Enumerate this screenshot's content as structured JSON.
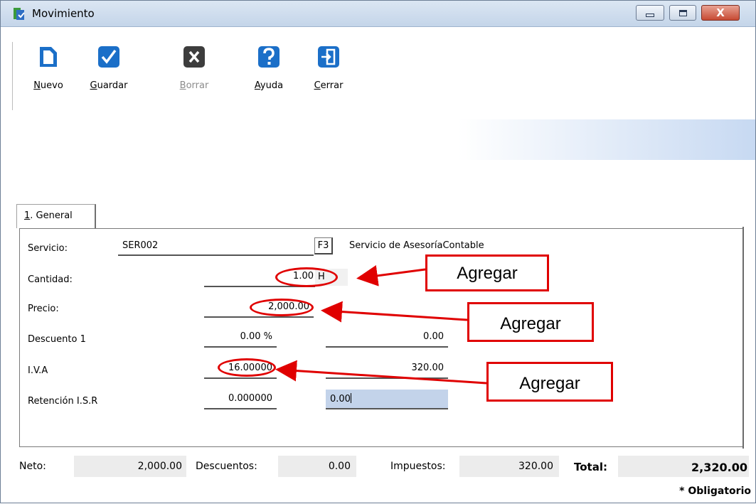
{
  "window": {
    "title": "Movimiento",
    "close_glyph": "X"
  },
  "toolbar": {
    "nuevo": "Nuevo",
    "guardar": "Guardar",
    "borrar": "Borrar",
    "ayuda": "Ayuda",
    "cerrar": "Cerrar"
  },
  "tab": {
    "number": "1",
    "label": ". General"
  },
  "form": {
    "servicio_label": "Servicio:",
    "servicio_code": "SER002",
    "f3_label": "F3",
    "servicio_desc": "Servicio de AsesoríaContable",
    "cantidad_label": "Cantidad:",
    "cantidad_value": "1.00",
    "cantidad_unit": "H",
    "precio_label": "Precio:",
    "precio_value": "2,000.00",
    "descuento_label": "Descuento 1",
    "descuento_pct": "0.00 %",
    "descuento_amount": "0.00",
    "iva_label": "I.V.A",
    "iva_pct": "16.00000",
    "iva_amount": "320.00",
    "retencion_label": "Retención I.S.R",
    "retencion_pct": "0.000000",
    "retencion_amount": "0.00"
  },
  "footer": {
    "neto_label": "Neto:",
    "neto_value": "2,000.00",
    "descuentos_label": "Descuentos:",
    "descuentos_value": "0.00",
    "impuestos_label": "Impuestos:",
    "impuestos_value": "320.00",
    "total_label": "Total:",
    "total_value": "2,320.00",
    "obligatorio": "* Obligatorio"
  },
  "annotations": {
    "callout_1": "Agregar",
    "callout_2": "Agregar",
    "callout_3": "Agregar",
    "color": "#e00000"
  },
  "icons": {
    "title": "app-icon",
    "nuevo": "new-document-icon",
    "guardar": "checkmark-icon",
    "borrar": "delete-x-icon",
    "ayuda": "help-question-icon",
    "cerrar": "exit-door-icon"
  }
}
